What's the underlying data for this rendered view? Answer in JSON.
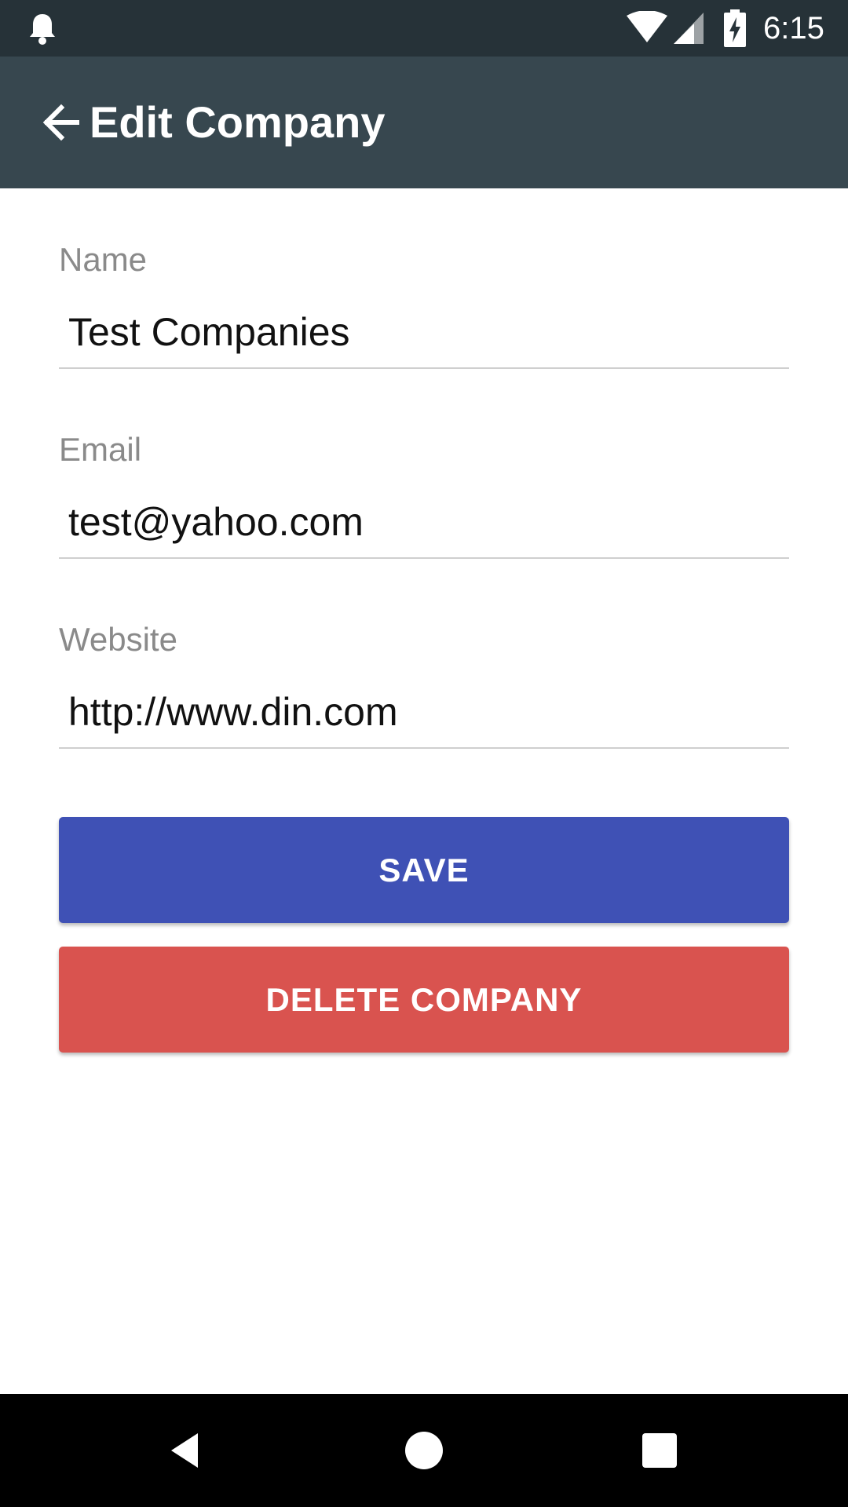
{
  "status_bar": {
    "time": "6:15",
    "icons": [
      "notification-bell-icon",
      "wifi-icon",
      "cell-signal-icon",
      "battery-charging-icon"
    ]
  },
  "app_bar": {
    "title": "Edit Company",
    "back_icon": "arrow-back-icon",
    "background": "#37474f"
  },
  "form": {
    "name": {
      "label": "Name",
      "value": "Test Companies"
    },
    "email": {
      "label": "Email",
      "value": "test@yahoo.com"
    },
    "website": {
      "label": "Website",
      "value": "http://www.din.com"
    }
  },
  "actions": {
    "save_label": "SAVE",
    "save_color": "#3f51b5",
    "delete_label": "DELETE COMPANY",
    "delete_color": "#d9534f"
  },
  "nav_bar": {
    "icons": [
      "nav-back-icon",
      "nav-home-icon",
      "nav-recents-icon"
    ]
  }
}
